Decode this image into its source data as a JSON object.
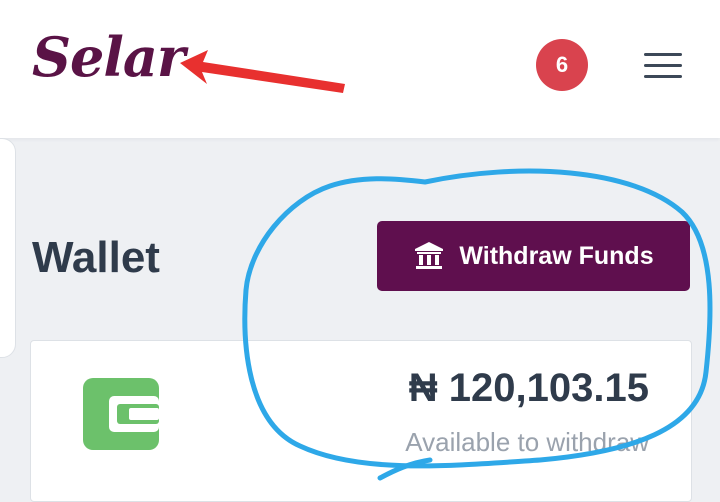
{
  "header": {
    "logo_text": "Selar",
    "notification_count": "6"
  },
  "page": {
    "title": "Wallet"
  },
  "actions": {
    "withdraw_label": "Withdraw Funds"
  },
  "wallet": {
    "balance": "₦ 120,103.15",
    "balance_label": "Available to withdraw"
  },
  "colors": {
    "brand": "#5f0f4e",
    "badge": "#d9434e",
    "wallet_icon": "#6cc16b",
    "annotation_arrow": "#e8302f",
    "annotation_circle": "#2ea8e8"
  },
  "icons": {
    "notification": "bell-count-badge",
    "menu": "hamburger-icon",
    "withdraw": "bank-icon",
    "wallet": "wallet-icon"
  }
}
